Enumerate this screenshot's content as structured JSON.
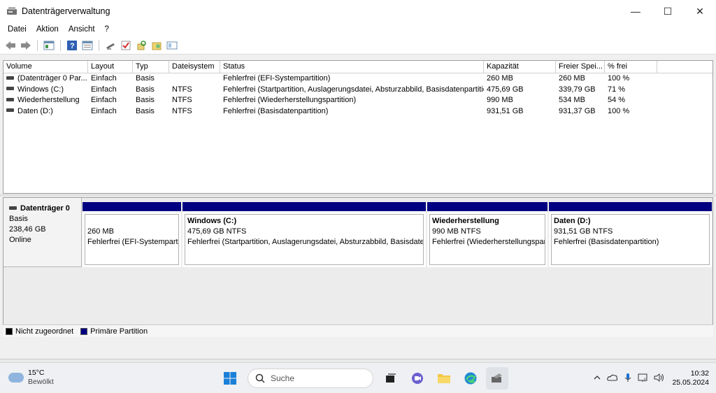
{
  "window": {
    "title": "Datenträgerverwaltung",
    "minimize": "—",
    "maximize": "☐",
    "close": "✕"
  },
  "menu": [
    "Datei",
    "Aktion",
    "Ansicht",
    "?"
  ],
  "toolbar_icons": [
    "back-icon",
    "forward-icon",
    "properties-icon",
    "help-icon",
    "view-icon",
    "disk-icon",
    "check-icon",
    "refresh-icon",
    "folder-icon",
    "console-icon"
  ],
  "list": {
    "headers": [
      "Volume",
      "Layout",
      "Typ",
      "Dateisystem",
      "Status",
      "Kapazität",
      "Freier Spei...",
      "% frei"
    ],
    "rows": [
      [
        "(Datenträger 0 Par...",
        "Einfach",
        "Basis",
        "",
        "Fehlerfrei (EFI-Systempartition)",
        "260 MB",
        "260 MB",
        "100 %"
      ],
      [
        "Windows (C:)",
        "Einfach",
        "Basis",
        "NTFS",
        "Fehlerfrei (Startpartition, Auslagerungsdatei, Absturzabbild, Basisdatenpartition)",
        "475,69 GB",
        "339,79 GB",
        "71 %"
      ],
      [
        "Wiederherstellung",
        "Einfach",
        "Basis",
        "NTFS",
        "Fehlerfrei (Wiederherstellungspartition)",
        "990 MB",
        "534 MB",
        "54 %"
      ],
      [
        "Daten (D:)",
        "Einfach",
        "Basis",
        "NTFS",
        "Fehlerfrei (Basisdatenpartition)",
        "931,51 GB",
        "931,37 GB",
        "100 %"
      ]
    ]
  },
  "disk": {
    "name": "Datenträger 0",
    "type": "Basis",
    "size": "238,46 GB",
    "state": "Online",
    "partitions": [
      {
        "title": "",
        "size": "260 MB",
        "status": "Fehlerfrei (EFI-Systempartition"
      },
      {
        "title": "Windows  (C:)",
        "size": "475,69 GB NTFS",
        "status": "Fehlerfrei (Startpartition, Auslagerungsdatei, Absturzabbild, Basisdatenpartition"
      },
      {
        "title": "Wiederherstellung",
        "size": "990 MB NTFS",
        "status": "Fehlerfrei (Wiederherstellungspartitior"
      },
      {
        "title": "Daten  (D:)",
        "size": "931,51 GB NTFS",
        "status": "Fehlerfrei (Basisdatenpartition)"
      }
    ]
  },
  "legend": [
    {
      "label": "Nicht zugeordnet",
      "color": "#000000"
    },
    {
      "label": "Primäre Partition",
      "color": "#000080"
    }
  ],
  "taskbar": {
    "weather_temp": "15°C",
    "weather_desc": "Bewölkt",
    "search_placeholder": "Suche",
    "time": "10:32",
    "date": "25.05.2024"
  },
  "colors": {
    "partition_bar": "#000080",
    "accent": "#0067c0"
  }
}
